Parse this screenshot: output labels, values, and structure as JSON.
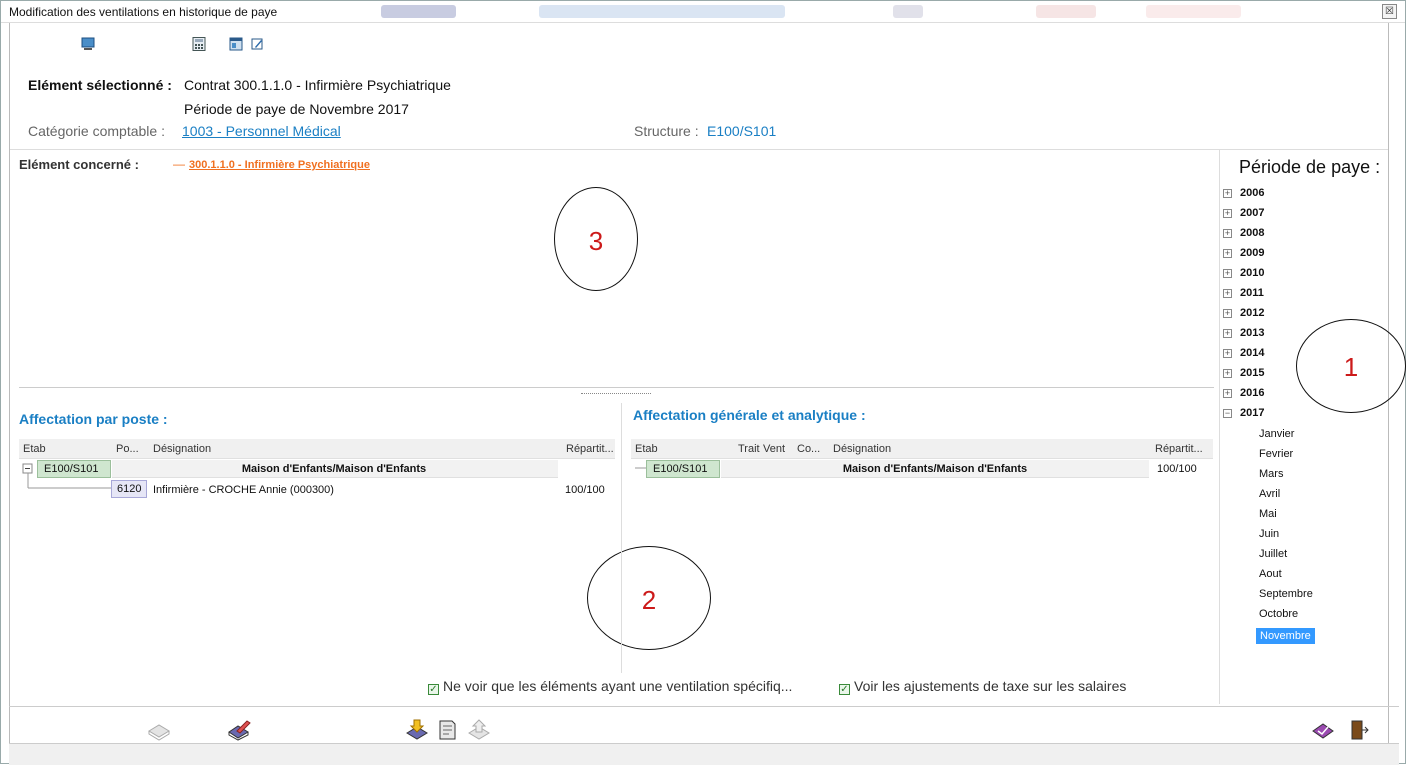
{
  "window": {
    "title": "Modification des ventilations en historique de paye",
    "close_glyph": "☒"
  },
  "toolbar": {
    "icons": [
      "monitor-icon",
      "calculator-icon",
      "window-icon",
      "edit-icon"
    ]
  },
  "header": {
    "selected_label": "Elément sélectionné :",
    "selected_value": "Contrat 300.1.1.0 - Infirmière Psychiatrique",
    "period_text": "Période de paye de Novembre 2017",
    "category_label": "Catégorie comptable :",
    "category_value": "1003 - Personnel Médical",
    "structure_label": "Structure :",
    "structure_value": "E100/S101"
  },
  "element": {
    "label": "Elément concerné :",
    "dash": "—",
    "value": "300.1.1.0 - Infirmière Psychiatrique"
  },
  "annotations": {
    "one": "1",
    "two": "2",
    "three": "3"
  },
  "period_panel": {
    "title": "Période de paye :",
    "years": [
      {
        "label": "2006",
        "sign": "+"
      },
      {
        "label": "2007",
        "sign": "+"
      },
      {
        "label": "2008",
        "sign": "+"
      },
      {
        "label": "2009",
        "sign": "+"
      },
      {
        "label": "2010",
        "sign": "+"
      },
      {
        "label": "2011",
        "sign": "+"
      },
      {
        "label": "2012",
        "sign": "+"
      },
      {
        "label": "2013",
        "sign": "+"
      },
      {
        "label": "2014",
        "sign": "+"
      },
      {
        "label": "2015",
        "sign": "+"
      },
      {
        "label": "2016",
        "sign": "+"
      },
      {
        "label": "2017",
        "sign": "−"
      }
    ],
    "months": [
      "Janvier",
      "Fevrier",
      "Mars",
      "Avril",
      "Mai",
      "Juin",
      "Juillet",
      "Aout",
      "Septembre",
      "Octobre",
      "Novembre"
    ],
    "selected_month": "Novembre"
  },
  "poste": {
    "title": "Affectation par poste :",
    "columns": [
      "Etab",
      "Po...",
      "Désignation",
      "Répartit..."
    ],
    "row1": {
      "etab": "E100/S101",
      "designation": "Maison d'Enfants/Maison d'Enfants",
      "repartition": ""
    },
    "row2": {
      "poste": "6120",
      "designation": "Infirmière - CROCHE Annie (000300)",
      "repartition": "100/100"
    }
  },
  "generale": {
    "title": "Affectation générale et analytique :",
    "columns": [
      "Etab",
      "Trait",
      "Vent",
      "Co...",
      "Désignation",
      "Répartit..."
    ],
    "row1": {
      "etab": "E100/S101",
      "designation": "Maison d'Enfants/Maison d'Enfants",
      "repartition": "100/100"
    }
  },
  "checkboxes": {
    "only_specific": "Ne voir que les éléments ayant une ventilation spécifiq...",
    "tax_adjust": "Voir les ajustements de taxe sur les salaires",
    "mark": "✓"
  },
  "footer": {
    "icons": [
      "book-disabled-icon",
      "book-edit-icon",
      "import-icon",
      "document-icon",
      "export-disabled-icon",
      "validate-icon",
      "exit-door-icon"
    ]
  }
}
